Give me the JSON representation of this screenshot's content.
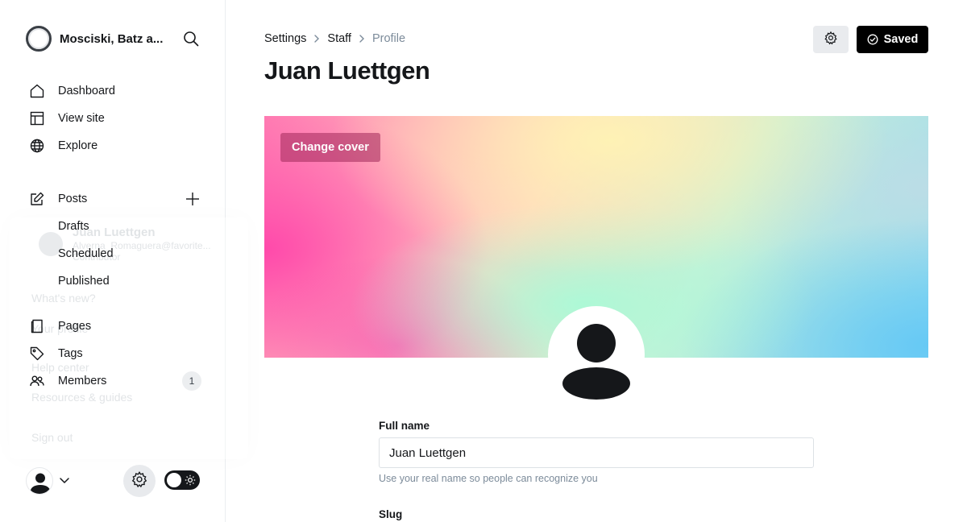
{
  "sidebar": {
    "site_name": "Mosciski, Batz a...",
    "nav": {
      "dashboard": "Dashboard",
      "view_site": "View site",
      "explore": "Explore",
      "posts": "Posts",
      "drafts": "Drafts",
      "scheduled": "Scheduled",
      "published": "Published",
      "pages": "Pages",
      "tags": "Tags",
      "members": "Members",
      "members_count": "1"
    },
    "ghost_menu": {
      "name": "Juan Luettgen",
      "email": "Alverna_Romaguera@favorite...",
      "role": "Contributor",
      "whats_new": "What's new?",
      "your_profile": "Your profile",
      "help_center": "Help center",
      "resources": "Resources & guides",
      "sign_out": "Sign out"
    }
  },
  "header": {
    "breadcrumb": [
      "Settings",
      "Staff",
      "Profile"
    ],
    "title": "Juan Luettgen",
    "saved_label": "Saved"
  },
  "cover": {
    "change_label": "Change cover"
  },
  "form": {
    "full_name_label": "Full name",
    "full_name_value": "Juan Luettgen",
    "full_name_hint": "Use your real name so people can recognize you",
    "slug_label": "Slug"
  },
  "colors": {
    "accent": "#000000",
    "text": "#15171a",
    "muted": "#7c8b9a"
  }
}
